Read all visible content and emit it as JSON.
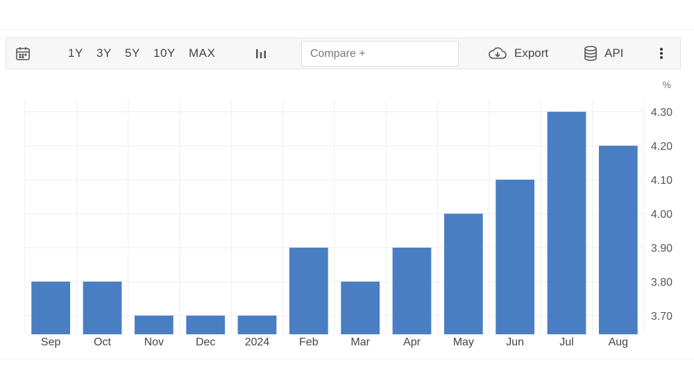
{
  "toolbar": {
    "ranges": [
      "1Y",
      "3Y",
      "5Y",
      "10Y",
      "MAX"
    ],
    "compare_placeholder": "Compare +",
    "export_label": "Export",
    "api_label": "API",
    "icons": [
      "calendar-icon",
      "bar-chart-icon",
      "cloud-download-icon",
      "database-icon",
      "more-vertical-icon"
    ]
  },
  "chart_data": {
    "type": "bar",
    "categories": [
      "Sep",
      "Oct",
      "Nov",
      "Dec",
      "2024",
      "Feb",
      "Mar",
      "Apr",
      "May",
      "Jun",
      "Jul",
      "Aug"
    ],
    "values": [
      3.8,
      3.8,
      3.7,
      3.7,
      3.7,
      3.9,
      3.8,
      3.9,
      4.0,
      4.1,
      4.3,
      4.2
    ],
    "unit_label": "%",
    "ylim": [
      3.645,
      4.335
    ],
    "yticks": [
      "3.70",
      "3.80",
      "3.90",
      "4.00",
      "4.10",
      "4.20",
      "4.30"
    ],
    "grid": true,
    "y_axis_side": "right",
    "bar_color": "#4a7ec2"
  }
}
